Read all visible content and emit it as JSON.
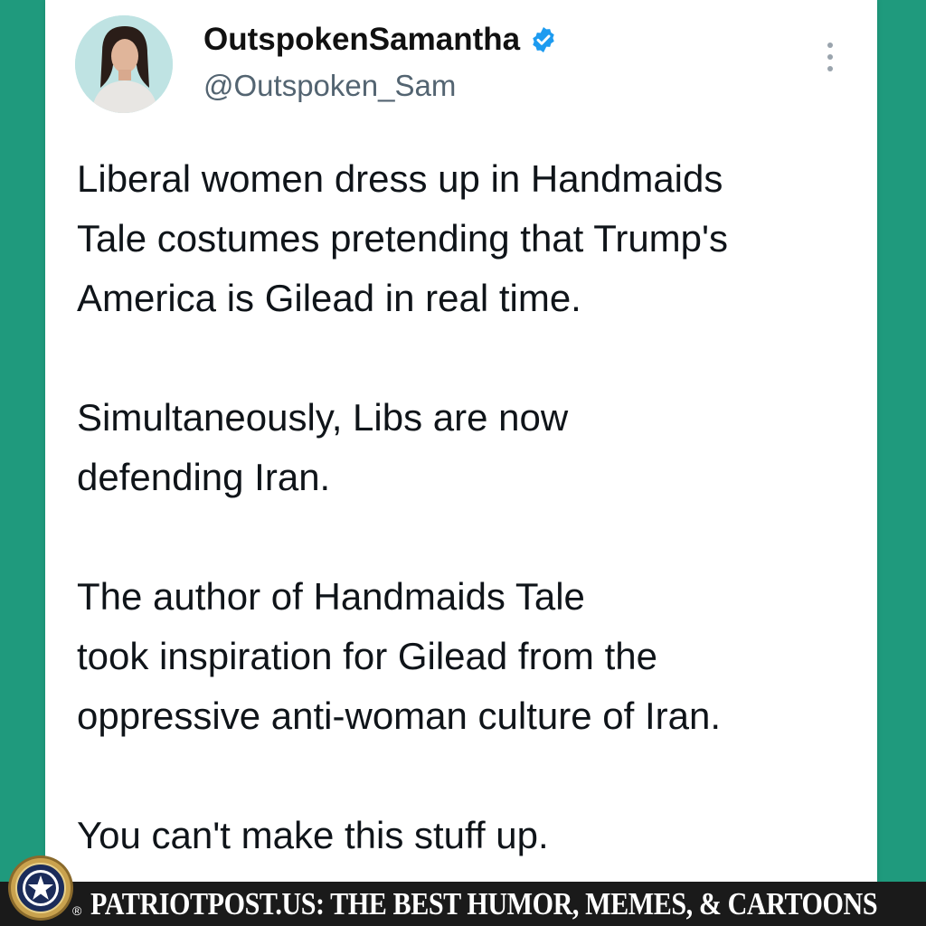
{
  "tweet": {
    "display_name": "OutspokenSamantha",
    "handle": "@Outspoken_Sam",
    "verified_color": "#1d9bf0",
    "paragraphs": [
      [
        "Liberal women dress up in Handmaids",
        "Tale costumes pretending that Trump's",
        "America is Gilead in real time."
      ],
      [
        "Simultaneously, Libs are now",
        "defending Iran."
      ],
      [
        "The author of Handmaids Tale",
        "took inspiration for Gilead from the",
        "oppressive anti-woman culture of Iran."
      ],
      [
        "You can't make this stuff up."
      ]
    ]
  },
  "footer": {
    "text": "PATRIOTPOST.US: THE BEST HUMOR, MEMES, & CARTOONS",
    "reg_mark": "®"
  },
  "colors": {
    "background": "#1f9a7d",
    "card": "#ffffff",
    "footer": "#1a1a1a"
  }
}
